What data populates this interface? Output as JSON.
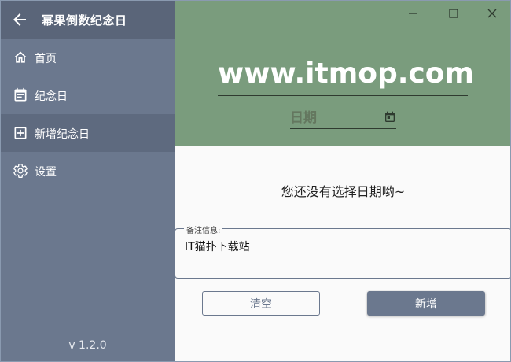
{
  "app": {
    "title": "幂果倒数纪念日",
    "version": "v 1.2.0"
  },
  "sidebar": {
    "items": [
      {
        "label": "首页",
        "icon": "home-icon",
        "active": false
      },
      {
        "label": "纪念日",
        "icon": "event-note-icon",
        "active": false
      },
      {
        "label": "新增纪念日",
        "icon": "add-box-icon",
        "active": true
      },
      {
        "label": "设置",
        "icon": "gear-icon",
        "active": false
      }
    ]
  },
  "hero": {
    "title": "www.itmop.com",
    "date_placeholder": "日期"
  },
  "main": {
    "prompt": "您还没有选择日期哟~",
    "remark_label": "备注信息:",
    "remark_value": "IT猫扑下载站",
    "clear_label": "清空",
    "add_label": "新增"
  },
  "colors": {
    "sidebar": "#6b788e",
    "sidebar_header": "#5a6579",
    "hero_bg": "#7a9c7d",
    "primary": "#6b788e"
  }
}
